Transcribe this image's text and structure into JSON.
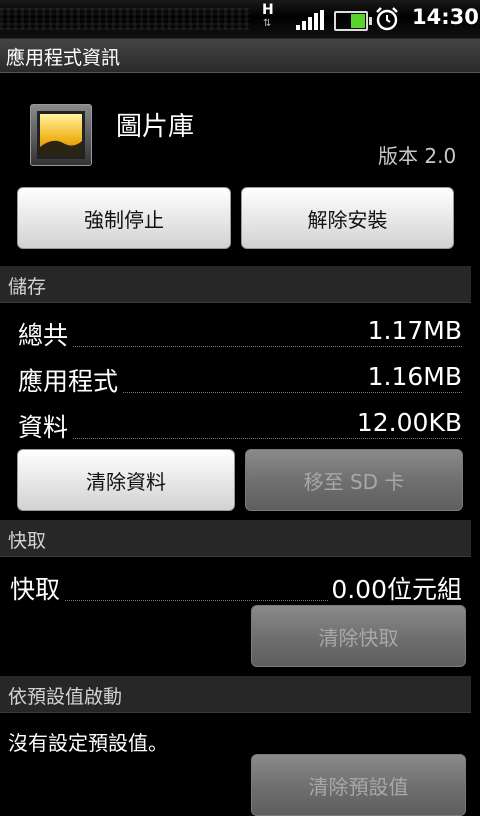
{
  "status_bar": {
    "network_type": "H",
    "network_arrows": "⇅",
    "signal_icon": "signal-strength-icon",
    "battery_icon": "battery-icon",
    "alarm_icon": "alarm-clock-icon",
    "time": "14:30"
  },
  "title_bar": {
    "title": "應用程式資訊"
  },
  "app": {
    "icon": "gallery-icon",
    "name": "圖片庫",
    "version": "版本 2.0"
  },
  "actions": {
    "force_stop": "強制停止",
    "uninstall": "解除安裝"
  },
  "storage": {
    "header": "儲存",
    "rows": [
      {
        "label": "總共",
        "value": "1.17MB"
      },
      {
        "label": "應用程式",
        "value": "1.16MB"
      },
      {
        "label": "資料",
        "value": "12.00KB"
      }
    ],
    "clear_data": "清除資料",
    "move_to_sd": "移至 SD 卡"
  },
  "cache": {
    "header": "快取",
    "label": "快取",
    "value": "0.00位元組",
    "clear_cache": "清除快取"
  },
  "launch_default": {
    "header": "依預設值啟動",
    "message": "沒有設定預設值。",
    "clear_defaults": "清除預設值"
  },
  "colors": {
    "background": "#000000",
    "section_header": "#272727",
    "button_enabled": "#e6e6e6",
    "button_disabled": "#6e6e6e",
    "battery_fill": "#5bd32f"
  }
}
